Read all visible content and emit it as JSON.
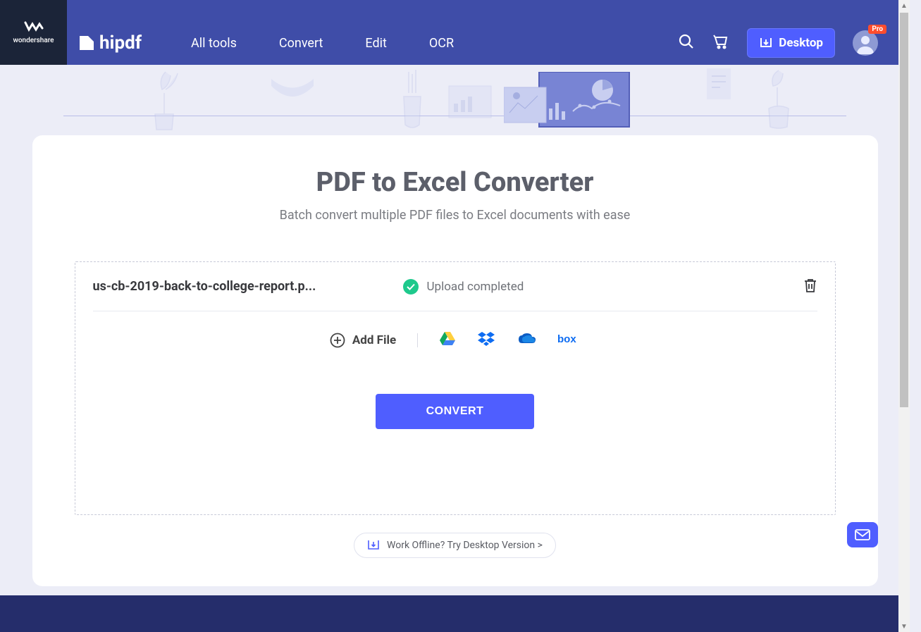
{
  "brand": {
    "parent": "wondershare",
    "name": "hipdf"
  },
  "nav": {
    "items": [
      "All tools",
      "Convert",
      "Edit",
      "OCR"
    ]
  },
  "header": {
    "desktop_label": "Desktop",
    "pro_badge": "Pro"
  },
  "page": {
    "title": "PDF to Excel Converter",
    "subtitle": "Batch convert multiple PDF files to Excel documents with ease"
  },
  "file": {
    "name": "us-cb-2019-back-to-college-report.p...",
    "status": "Upload completed"
  },
  "actions": {
    "add_file": "Add File",
    "convert": "CONVERT",
    "offline": "Work Offline? Try Desktop Version >"
  },
  "cloud_providers": [
    "google-drive",
    "dropbox",
    "onedrive",
    "box"
  ]
}
